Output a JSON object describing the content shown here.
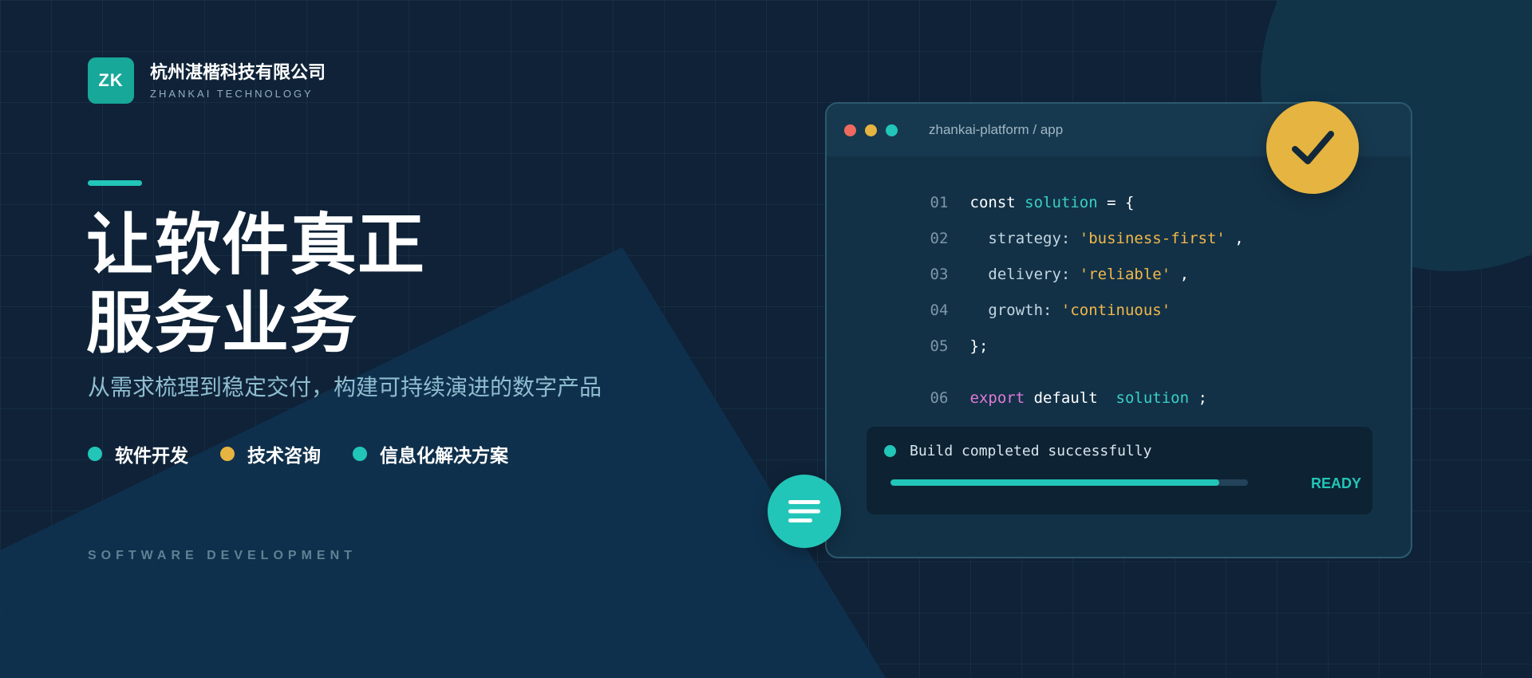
{
  "brand": {
    "logo_text": "ZK",
    "name": "杭州湛楷科技有限公司",
    "name_en": "ZHANKAI TECHNOLOGY"
  },
  "hero": {
    "title_line1": "让软件真正",
    "title_line2": "服务业务",
    "subtitle": "从需求梳理到稳定交付，构建可持续演进的数字产品"
  },
  "services": [
    {
      "label": "软件开发",
      "color": "#22c6b8"
    },
    {
      "label": "技术咨询",
      "color": "#e6b440"
    },
    {
      "label": "信息化解决方案",
      "color": "#22c6b8"
    }
  ],
  "footer_tag": "SOFTWARE DEVELOPMENT",
  "code_window": {
    "path": "zhankai-platform / app",
    "traffic_lights": [
      "#ee6a5f",
      "#e6b440",
      "#22c6b8"
    ],
    "lines": [
      {
        "num": "01",
        "tokens": [
          {
            "text": "const",
            "t": "w"
          },
          {
            "text": " solution",
            "t": "c"
          },
          {
            "text": " = {",
            "t": "w"
          }
        ]
      },
      {
        "num": "02",
        "tokens": [
          {
            "text": "  strategy:",
            "t": "p"
          },
          {
            "text": " 'business-first'",
            "t": "s"
          },
          {
            "text": " ,",
            "t": "w"
          }
        ]
      },
      {
        "num": "03",
        "tokens": [
          {
            "text": "  delivery:",
            "t": "p"
          },
          {
            "text": " 'reliable'",
            "t": "s"
          },
          {
            "text": " ,",
            "t": "w"
          }
        ]
      },
      {
        "num": "04",
        "tokens": [
          {
            "text": "  growth:",
            "t": "p"
          },
          {
            "text": " 'continuous'",
            "t": "s"
          }
        ]
      },
      {
        "num": "05",
        "tokens": [
          {
            "text": "};",
            "t": "w"
          }
        ]
      },
      {
        "num": "06",
        "tokens": [
          {
            "text": "export",
            "t": "k"
          },
          {
            "text": " default ",
            "t": "w"
          },
          {
            "text": " solution",
            "t": "c"
          },
          {
            "text": " ;",
            "t": "w"
          }
        ]
      }
    ],
    "build": {
      "message": "Build completed successfully",
      "progress_percent": 92,
      "status": "READY"
    }
  },
  "badges": {
    "check_icon": "checkmark-icon",
    "menu_icon": "menu-icon"
  },
  "colors": {
    "teal": "#22c6b8",
    "gold": "#e6b440",
    "background": "#0f2237"
  }
}
